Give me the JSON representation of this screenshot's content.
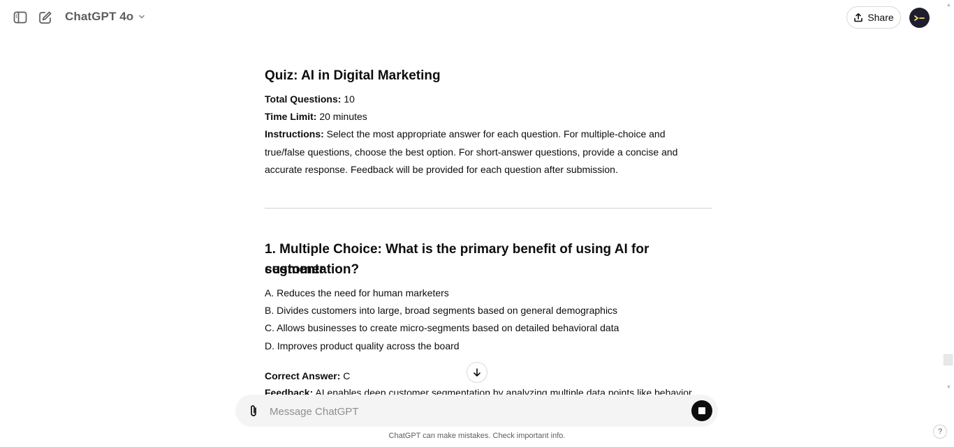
{
  "header": {
    "model_name": "ChatGPT 4o",
    "share_label": "Share"
  },
  "article": {
    "title": "Quiz: AI in Digital Marketing",
    "total_questions_label": "Total Questions:",
    "total_questions_value": "10",
    "time_limit_label": "Time Limit:",
    "time_limit_value": "20 minutes",
    "instructions_label": "Instructions:",
    "instructions_text": "Select the most appropriate answer for each question. For multiple-choice and true/false questions, choose the best option. For short-answer questions, provide a concise and accurate response. Feedback will be provided for each question after submission.",
    "question1": {
      "heading_line1": "1. Multiple Choice: What is the primary benefit of using AI for customer",
      "heading_line2": "segmentation?",
      "options": [
        "A. Reduces the need for human marketers",
        "B. Divides customers into large, broad segments based on general demographics",
        "C. Allows businesses to create micro-segments based on detailed behavioral data",
        "D. Improves product quality across the board"
      ],
      "correct_answer_label": "Correct Answer:",
      "correct_answer_value": "C",
      "feedback_label": "Feedback:",
      "feedback_text": "AI enables deep customer segmentation by analyzing multiple data points like behavior"
    }
  },
  "composer": {
    "placeholder": "Message ChatGPT",
    "disclaimer": "ChatGPT can make mistakes. Check important info."
  },
  "help_label": "?"
}
